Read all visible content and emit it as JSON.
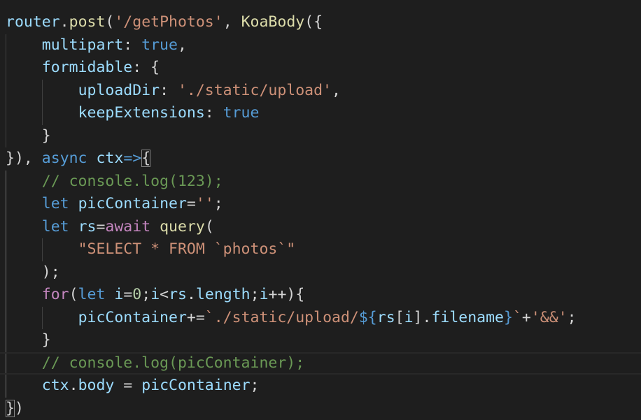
{
  "editor": {
    "theme": {
      "background": "#1e1e1e",
      "default": "#d4d4d4",
      "variable": "#9cdcfe",
      "function": "#dcdcaa",
      "string": "#ce9178",
      "keyword": "#569cd6",
      "control": "#c586c0",
      "number": "#b5cea8",
      "comment": "#6a9955"
    },
    "current_line": 16,
    "lines": [
      [
        [
          "var",
          "router"
        ],
        [
          "punc",
          "."
        ],
        [
          "fn",
          "post"
        ],
        [
          "punc",
          "("
        ],
        [
          "str",
          "'/getPhotos'"
        ],
        [
          "punc",
          ", "
        ],
        [
          "fn",
          "KoaBody"
        ],
        [
          "punc",
          "({"
        ]
      ],
      [
        [
          "punc",
          "    "
        ],
        [
          "var",
          "multipart"
        ],
        [
          "punc",
          ": "
        ],
        [
          "kw",
          "true"
        ],
        [
          "punc",
          ","
        ]
      ],
      [
        [
          "punc",
          "    "
        ],
        [
          "var",
          "formidable"
        ],
        [
          "punc",
          ": {"
        ]
      ],
      [
        [
          "punc",
          "        "
        ],
        [
          "var",
          "uploadDir"
        ],
        [
          "punc",
          ": "
        ],
        [
          "str",
          "'./static/upload'"
        ],
        [
          "punc",
          ","
        ]
      ],
      [
        [
          "punc",
          "        "
        ],
        [
          "var",
          "keepExtensions"
        ],
        [
          "punc",
          ": "
        ],
        [
          "kw",
          "true"
        ]
      ],
      [
        [
          "punc",
          "    }"
        ]
      ],
      [
        [
          "punc",
          "}), "
        ],
        [
          "kw",
          "async"
        ],
        [
          "punc",
          " "
        ],
        [
          "var",
          "ctx"
        ],
        [
          "kw",
          "=>"
        ],
        [
          "punc",
          "{"
        ]
      ],
      [
        [
          "punc",
          "    "
        ],
        [
          "com",
          "// console.log(123);"
        ]
      ],
      [
        [
          "punc",
          "    "
        ],
        [
          "kw",
          "let"
        ],
        [
          "punc",
          " "
        ],
        [
          "var",
          "picContainer"
        ],
        [
          "punc",
          "="
        ],
        [
          "str",
          "''"
        ],
        [
          "punc",
          ";"
        ]
      ],
      [
        [
          "punc",
          "    "
        ],
        [
          "kw",
          "let"
        ],
        [
          "punc",
          " "
        ],
        [
          "var",
          "rs"
        ],
        [
          "punc",
          "="
        ],
        [
          "ctrl",
          "await"
        ],
        [
          "punc",
          " "
        ],
        [
          "fn",
          "query"
        ],
        [
          "punc",
          "("
        ]
      ],
      [
        [
          "punc",
          "        "
        ],
        [
          "str",
          "\"SELECT * FROM `photos`\""
        ]
      ],
      [
        [
          "punc",
          "    );"
        ]
      ],
      [
        [
          "punc",
          "    "
        ],
        [
          "ctrl",
          "for"
        ],
        [
          "punc",
          "("
        ],
        [
          "kw",
          "let"
        ],
        [
          "punc",
          " "
        ],
        [
          "var",
          "i"
        ],
        [
          "punc",
          "="
        ],
        [
          "num",
          "0"
        ],
        [
          "punc",
          ";"
        ],
        [
          "var",
          "i"
        ],
        [
          "punc",
          "<"
        ],
        [
          "var",
          "rs"
        ],
        [
          "punc",
          "."
        ],
        [
          "var",
          "length"
        ],
        [
          "punc",
          ";"
        ],
        [
          "var",
          "i"
        ],
        [
          "punc",
          "++){"
        ]
      ],
      [
        [
          "punc",
          "        "
        ],
        [
          "var",
          "picContainer"
        ],
        [
          "punc",
          "+="
        ],
        [
          "str",
          "`./static/upload/"
        ],
        [
          "kw",
          "${"
        ],
        [
          "var",
          "rs"
        ],
        [
          "punc",
          "["
        ],
        [
          "var",
          "i"
        ],
        [
          "punc",
          "]."
        ],
        [
          "var",
          "filename"
        ],
        [
          "kw",
          "}"
        ],
        [
          "str",
          "`"
        ],
        [
          "punc",
          "+"
        ],
        [
          "str",
          "'&&'"
        ],
        [
          "punc",
          ";"
        ]
      ],
      [
        [
          "punc",
          "    }"
        ]
      ],
      [
        [
          "punc",
          "    "
        ],
        [
          "com",
          "// console.log(picContainer);"
        ]
      ],
      [
        [
          "punc",
          "    "
        ],
        [
          "var",
          "ctx"
        ],
        [
          "punc",
          "."
        ],
        [
          "var",
          "body"
        ],
        [
          "punc",
          " = "
        ],
        [
          "var",
          "picContainer"
        ],
        [
          "punc",
          ";"
        ]
      ],
      [
        [
          "punc",
          "})"
        ]
      ]
    ]
  }
}
